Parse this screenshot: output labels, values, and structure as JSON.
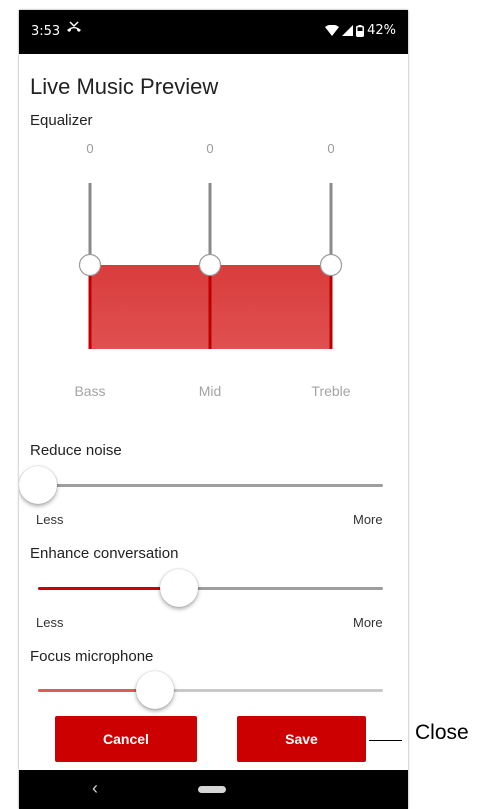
{
  "status_bar": {
    "time": "3:53",
    "extra_icon": "missed-call-icon",
    "battery": "42%"
  },
  "title": "Live Music Preview",
  "equalizer": {
    "label": "Equalizer",
    "bands": [
      {
        "name": "Bass",
        "value": "0"
      },
      {
        "name": "Mid",
        "value": "0"
      },
      {
        "name": "Treble",
        "value": "0"
      }
    ],
    "fill_color": "#d93c3c"
  },
  "sliders": [
    {
      "label": "Reduce noise",
      "level": 0.0,
      "min_label": "Less",
      "max_label": "More"
    },
    {
      "label": "Enhance conversation",
      "level": 0.41,
      "min_label": "Less",
      "max_label": "More"
    },
    {
      "label": "Focus microphone",
      "level": 0.34
    }
  ],
  "buttons": {
    "cancel": "Cancel",
    "save": "Save"
  },
  "annotation": {
    "label": "Close"
  },
  "colors": {
    "accent": "#cc0000",
    "track": "#9e9e9e"
  }
}
